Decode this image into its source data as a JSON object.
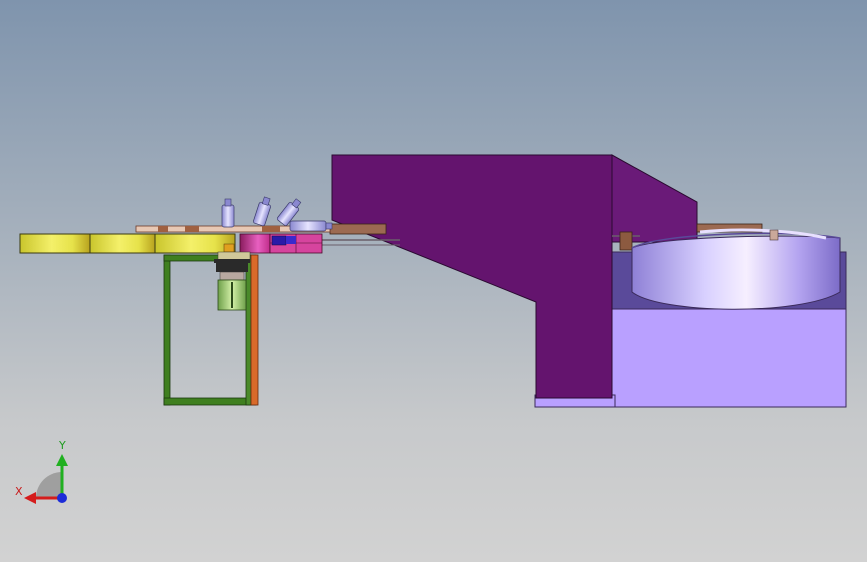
{
  "viewport": {
    "background_top": "#7f94ad",
    "background_bottom": "#d2d2d2"
  },
  "model": {
    "frame_color": "#3f7f1f",
    "frame_accent_color": "#d96a2a",
    "conveyor_color": "#e9e646",
    "hopper_color": "#64146e",
    "base_color": "#b9a0ff",
    "bowl_color": "#b8a6f2",
    "bottle_color": "#a9a7e6"
  },
  "triad": {
    "x_label": "X",
    "y_label": "Y",
    "x_color": "#d41c1c",
    "y_color": "#20b020",
    "z_color": "#1c2cd8"
  }
}
